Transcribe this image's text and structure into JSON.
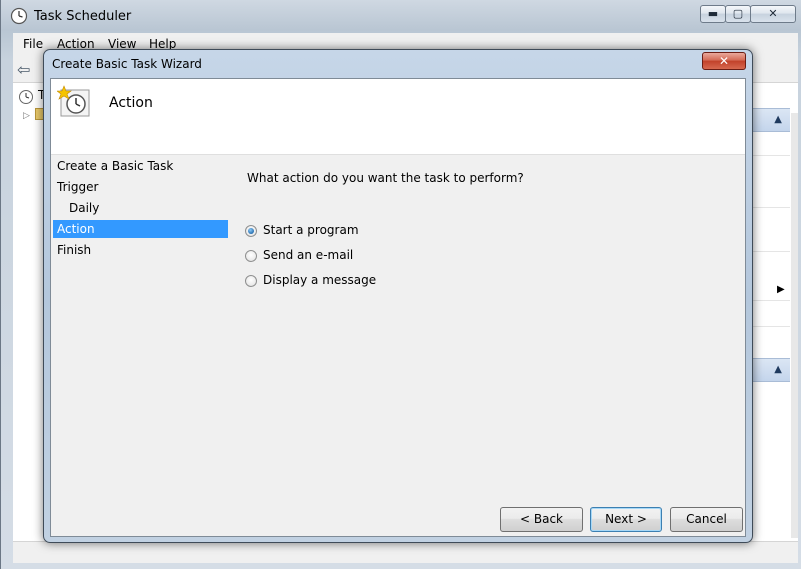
{
  "outer_window": {
    "title": "Task Scheduler",
    "menu": [
      "File",
      "Action",
      "View",
      "Help"
    ],
    "tree_item_partial": "T",
    "minimize_glyph": "▬",
    "maximize_glyph": "▢",
    "close_glyph": "✕"
  },
  "wizard": {
    "title": "Create Basic Task Wizard",
    "close_glyph": "✕",
    "header_title": "Action",
    "steps": [
      {
        "label": "Create a Basic Task"
      },
      {
        "label": "Trigger"
      },
      {
        "label": "Daily"
      },
      {
        "label": "Action"
      },
      {
        "label": "Finish"
      }
    ],
    "active_step": "Action",
    "question": "What action do you want the task to perform?",
    "options": [
      {
        "label": "Start a program",
        "checked": true
      },
      {
        "label": "Send an e-mail",
        "checked": false
      },
      {
        "label": "Display a message",
        "checked": false
      }
    ],
    "buttons": {
      "back": "< Back",
      "next": "Next >",
      "cancel": "Cancel"
    }
  },
  "colors": {
    "selection": "#3399ff",
    "dialog_frame": "#b4c7dc",
    "close_button": "#c2412a"
  }
}
